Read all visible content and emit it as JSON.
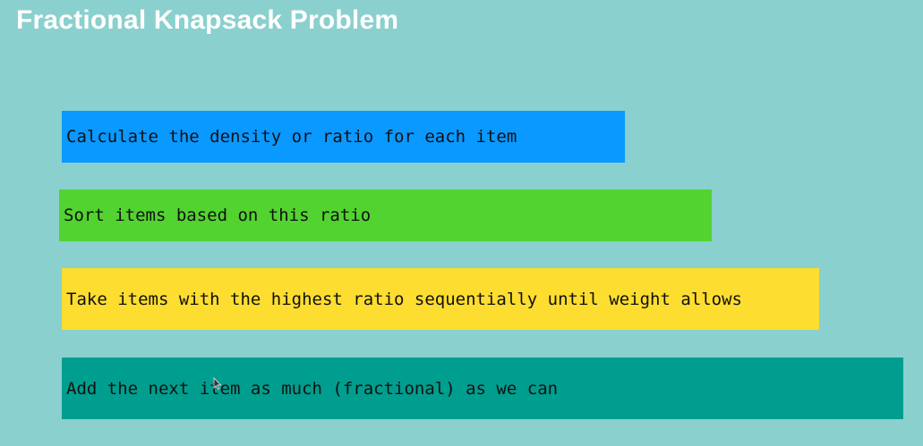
{
  "title": "Fractional Knapsack Problem",
  "steps": [
    {
      "label": "Calculate the density or ratio for each item",
      "color": "#0a99ff"
    },
    {
      "label": "Sort items based on this ratio",
      "color": "#52d330"
    },
    {
      "label": "Take items with the highest ratio sequentially until weight allows",
      "color": "#fddd2f"
    },
    {
      "label": "Add the next item as much (fractional) as we can",
      "color": "#009e8e"
    }
  ],
  "cursor_icon": "mouse-pointer-icon"
}
